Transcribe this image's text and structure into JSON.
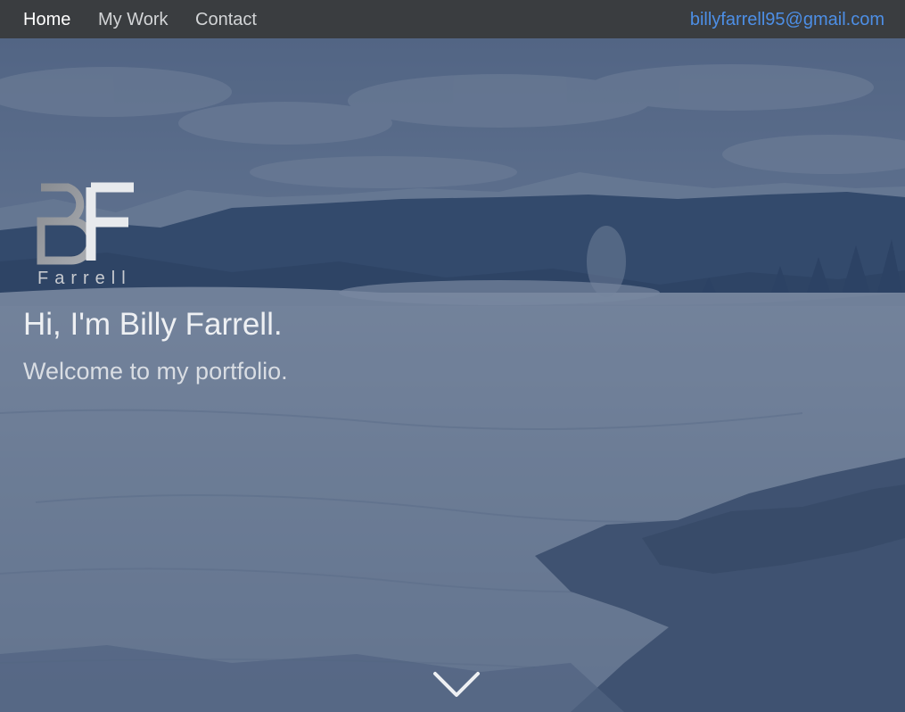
{
  "nav": {
    "links": [
      {
        "label": "Home"
      },
      {
        "label": "My Work"
      },
      {
        "label": "Contact"
      }
    ],
    "email": "billyfarrell95@gmail.com"
  },
  "logo": {
    "initials": "BF",
    "wordmark": "Farrell"
  },
  "hero": {
    "headline": "Hi, I'm Billy Farrell.",
    "subline": "Welcome to my portfolio."
  },
  "icons": {
    "scroll": "chevron-down-icon"
  },
  "colors": {
    "navbar": "#3a3d40",
    "overlay": "#2d4368",
    "email": "#4d8fe6",
    "text": "#eef0f3"
  }
}
